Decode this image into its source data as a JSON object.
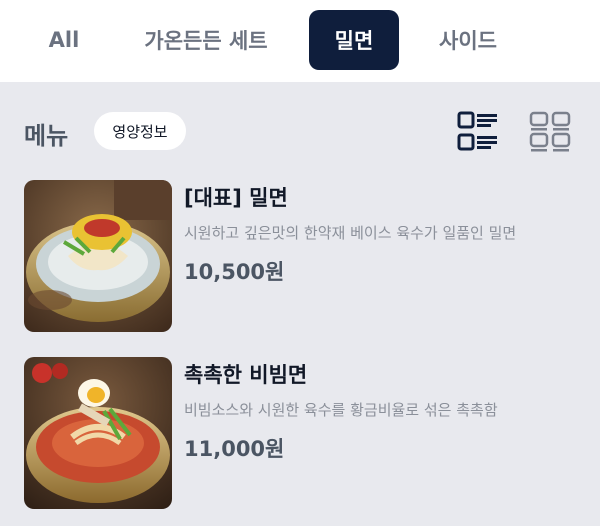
{
  "tabs": [
    {
      "label": "All",
      "active": false
    },
    {
      "label": "가온든든 세트",
      "active": false
    },
    {
      "label": "밀면",
      "active": true
    },
    {
      "label": "사이드",
      "active": false
    }
  ],
  "section": {
    "title": "메뉴",
    "nutrition_label": "영양정보",
    "view_icons": [
      "list-view-icon",
      "grid-view-icon"
    ]
  },
  "menu_items": [
    {
      "name": "[대표] 밀면",
      "description": "시원하고 깊은맛의 한약재 베이스 육수가 일품인 밀면",
      "price": "10,500원",
      "image": "cold-noodle-photo"
    },
    {
      "name": "촉촉한 비빔면",
      "description": "비빔소스와 시원한 육수를 황금비율로 섞은 촉촉함",
      "price": "11,000원",
      "image": "spicy-noodle-photo"
    }
  ],
  "colors": {
    "active_tab_bg": "#0f1e3c",
    "page_bg": "#e8e9ee",
    "tab_text": "#6b7280",
    "desc_text": "#8b909a"
  }
}
